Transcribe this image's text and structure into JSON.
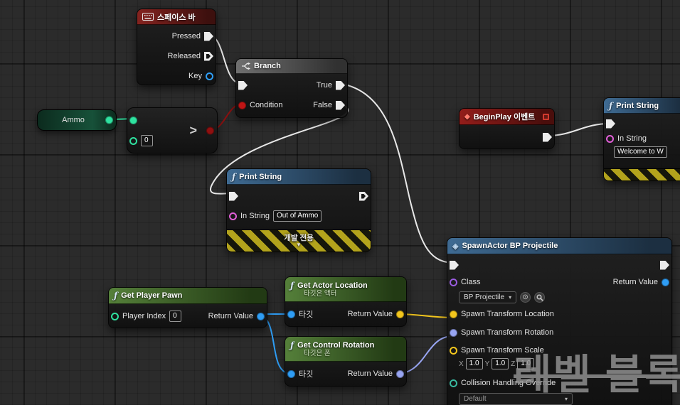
{
  "colors": {
    "exec_wire": "#e8e8e8",
    "data_green": "#2fe2a0",
    "bool_red": "#8f1010",
    "object_blue": "#2f9df4",
    "vector_yellow": "#f3c61d",
    "rotator_purple": "#98a5f2"
  },
  "watermark": {
    "text": "레벨 블록"
  },
  "nodes": {
    "spacebar": {
      "title": "스페이스 바",
      "pressed_label": "Pressed",
      "released_label": "Released",
      "key_label": "Key"
    },
    "ammo": {
      "label": "Ammo"
    },
    "greater": {
      "operator": ">",
      "value": "0"
    },
    "branch": {
      "title": "Branch",
      "condition_label": "Condition",
      "true_label": "True",
      "false_label": "False"
    },
    "print_out_of_ammo": {
      "title": "Print String",
      "in_string_label": "In String",
      "in_string_value": "Out of Ammo",
      "dev_banner_label": "개발 전용"
    },
    "beginplay": {
      "title": "BeginPlay 이벤트"
    },
    "print_welcome": {
      "title": "Print String",
      "in_string_label": "In String",
      "in_string_value": "Welcome to W"
    },
    "spawn_actor": {
      "title": "SpawnActor BP Projectile",
      "class_label": "Class",
      "class_value": "BP Projectile",
      "return_label": "Return Value",
      "location_label": "Spawn Transform Location",
      "rotation_label": "Spawn Transform Rotation",
      "scale_label": "Spawn Transform Scale",
      "x_label": "X",
      "y_label": "Y",
      "z_label": "Z",
      "scale_x": "1.0",
      "scale_y": "1.0",
      "scale_z": "1.0",
      "collision_label": "Collision Handling Override",
      "collision_value": "Default"
    },
    "get_player_pawn": {
      "title": "Get Player Pawn",
      "player_index_label": "Player Index",
      "player_index_value": "0",
      "return_label": "Return Value"
    },
    "get_actor_location": {
      "title": "Get Actor Location",
      "subtitle": "타깃은 액터",
      "target_label": "타깃",
      "return_label": "Return Value"
    },
    "get_control_rotation": {
      "title": "Get Control Rotation",
      "subtitle": "타깃은 폰",
      "target_label": "타깃",
      "return_label": "Return Value"
    }
  }
}
